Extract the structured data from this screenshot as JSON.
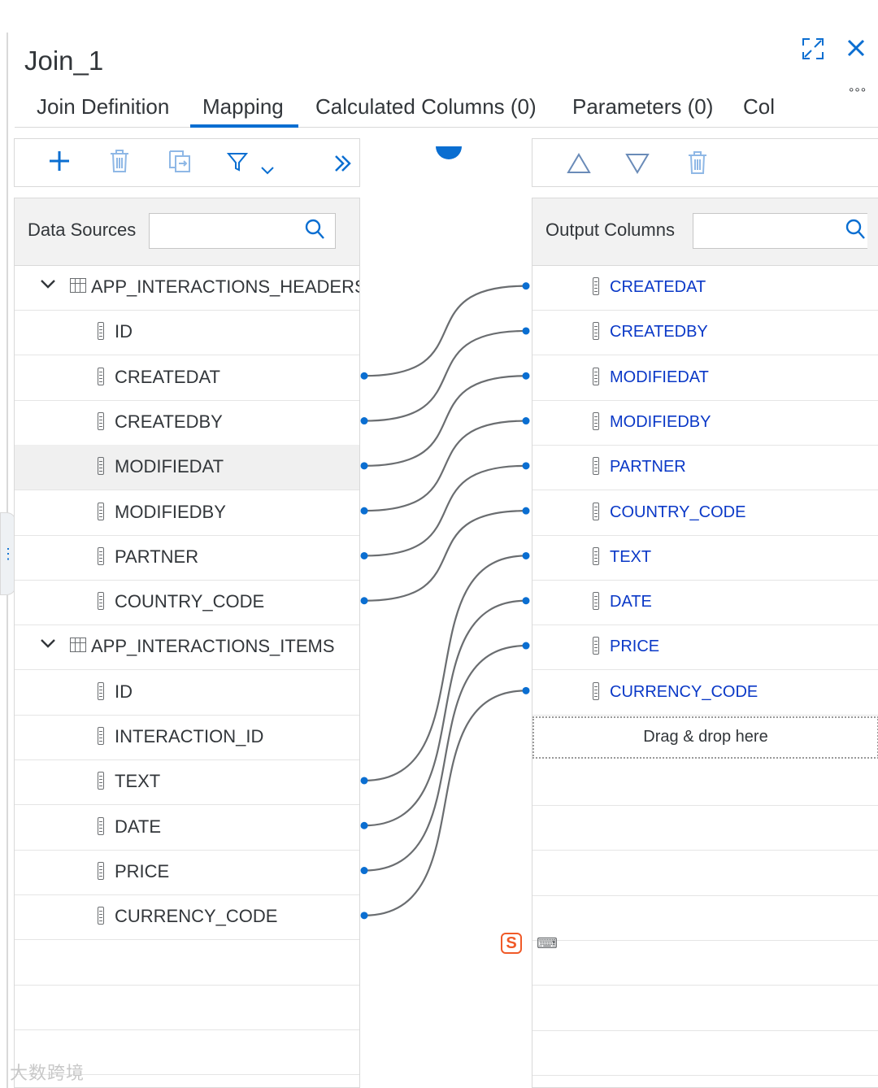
{
  "header": {
    "title": "Join_1",
    "expand_icon": "expand-icon",
    "close_icon": "close-icon",
    "more_icon": "overflow-icon",
    "more_glyph": "°°°"
  },
  "tabs": [
    {
      "label": "Join Definition",
      "active": false
    },
    {
      "label": "Mapping",
      "active": true
    },
    {
      "label": "Calculated Columns (0)",
      "active": false
    },
    {
      "label": "Parameters (0)",
      "active": false
    },
    {
      "label": "Col",
      "active": false
    }
  ],
  "left_toolbar": {
    "icons": [
      "add-icon",
      "delete-icon",
      "copy-icon",
      "filter-icon",
      "chevron-down-icon",
      "double-chevron-right-icon"
    ]
  },
  "right_toolbar": {
    "icons": [
      "move-up-icon",
      "move-down-icon",
      "delete-icon"
    ]
  },
  "data_sources": {
    "label": "Data Sources",
    "search_placeholder": "",
    "groups": [
      {
        "name": "APP_INTERACTIONS_HEADERS",
        "columns": [
          "ID",
          "CREATEDAT",
          "CREATEDBY",
          "MODIFIEDAT",
          "MODIFIEDBY",
          "PARTNER",
          "COUNTRY_CODE"
        ]
      },
      {
        "name": "APP_INTERACTIONS_ITEMS",
        "columns": [
          "ID",
          "INTERACTION_ID",
          "TEXT",
          "DATE",
          "PRICE",
          "CURRENCY_CODE"
        ]
      }
    ],
    "selected": "MODIFIEDAT"
  },
  "output_columns": {
    "label": "Output Columns",
    "search_placeholder": "",
    "columns": [
      "CREATEDAT",
      "CREATEDBY",
      "MODIFIEDAT",
      "MODIFIEDBY",
      "PARTNER",
      "COUNTRY_CODE",
      "TEXT",
      "DATE",
      "PRICE",
      "CURRENCY_CODE"
    ],
    "drop_hint": "Drag & drop here"
  },
  "mappings": [
    {
      "from": "APP_INTERACTIONS_HEADERS.CREATEDAT",
      "to": "CREATEDAT"
    },
    {
      "from": "APP_INTERACTIONS_HEADERS.CREATEDBY",
      "to": "CREATEDBY"
    },
    {
      "from": "APP_INTERACTIONS_HEADERS.MODIFIEDAT",
      "to": "MODIFIEDAT"
    },
    {
      "from": "APP_INTERACTIONS_HEADERS.MODIFIEDBY",
      "to": "MODIFIEDBY"
    },
    {
      "from": "APP_INTERACTIONS_HEADERS.PARTNER",
      "to": "PARTNER"
    },
    {
      "from": "APP_INTERACTIONS_HEADERS.COUNTRY_CODE",
      "to": "COUNTRY_CODE"
    },
    {
      "from": "APP_INTERACTIONS_ITEMS.TEXT",
      "to": "TEXT"
    },
    {
      "from": "APP_INTERACTIONS_ITEMS.DATE",
      "to": "DATE"
    },
    {
      "from": "APP_INTERACTIONS_ITEMS.PRICE",
      "to": "PRICE"
    },
    {
      "from": "APP_INTERACTIONS_ITEMS.CURRENCY_CODE",
      "to": "CURRENCY_CODE"
    }
  ],
  "colors": {
    "accent": "#0a6ed1",
    "output_text": "#0a38c7",
    "link_line": "#6a6d70"
  },
  "watermark": "大数跨境"
}
